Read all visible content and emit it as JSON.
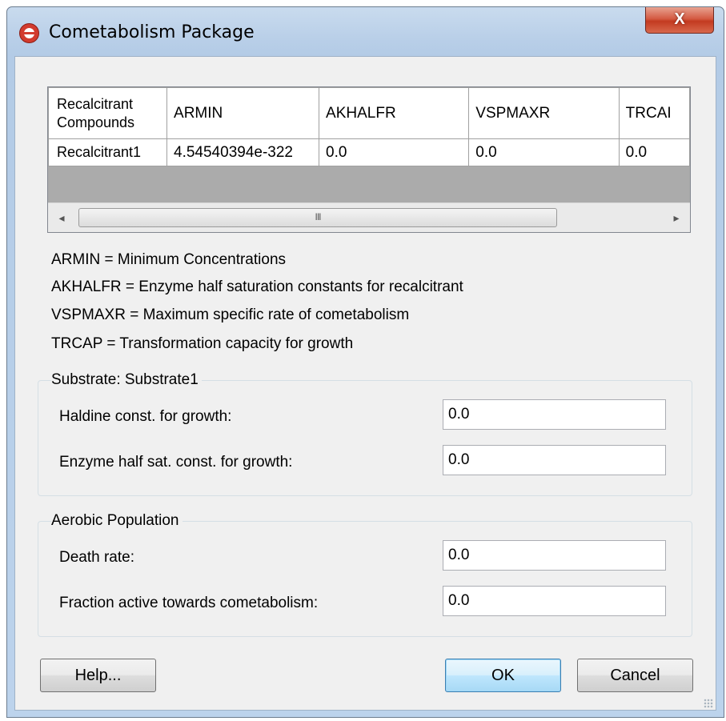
{
  "window": {
    "title": "Cometabolism Package",
    "close_label": "X"
  },
  "table": {
    "columns": [
      "Recalcitrant Compounds",
      "ARMIN",
      "AKHALFR",
      "VSPMAXR",
      "TRCAP"
    ],
    "header_visible": [
      "Recalcitrant\nCompounds",
      "ARMIN",
      "AKHALFR",
      "VSPMAXR",
      "TRCAI"
    ],
    "rows": [
      [
        "Recalcitrant1",
        "4.54540394e-322",
        "0.0",
        "0.0",
        "0.0"
      ]
    ]
  },
  "scrollbar": {
    "left_arrow": "◂",
    "right_arrow": "▸",
    "thumb_grip": "III"
  },
  "legend": [
    "ARMIN = Minimum Concentrations",
    "AKHALFR = Enzyme half saturation constants for recalcitrant",
    "VSPMAXR = Maximum specific rate of cometabolism",
    "TRCAP = Transformation capacity for growth"
  ],
  "substrate_group": {
    "title": "Substrate: Substrate1",
    "fields": [
      {
        "label": "Haldine const. for growth:",
        "value": "0.0"
      },
      {
        "label": "Enzyme half sat. const. for growth:",
        "value": "0.0"
      }
    ]
  },
  "aerobic_group": {
    "title": "Aerobic Population",
    "fields": [
      {
        "label": "Death rate:",
        "value": "0.0"
      },
      {
        "label": "Fraction active towards cometabolism:",
        "value": "0.0"
      }
    ]
  },
  "buttons": {
    "help": "Help...",
    "ok": "OK",
    "cancel": "Cancel"
  }
}
